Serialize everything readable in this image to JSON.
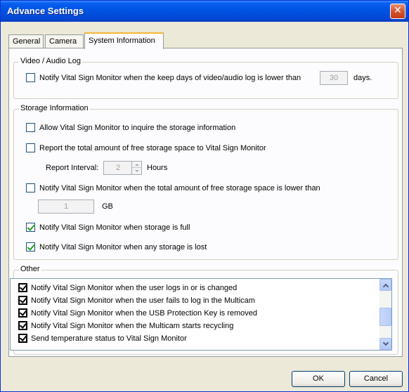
{
  "window": {
    "title": "Advance Settings",
    "close_glyph": "✕"
  },
  "tabs": [
    {
      "label": "General"
    },
    {
      "label": "Camera"
    },
    {
      "label": "System Information",
      "active": true
    }
  ],
  "video_audio": {
    "group_label": "Video / Audio Log",
    "notify_keep_days": {
      "label": "Notify Vital Sign Monitor when the keep days of video/audio log is lower than",
      "checked": false
    },
    "days_value": "30",
    "days_unit": "days."
  },
  "storage": {
    "group_label": "Storage Information",
    "allow_inquire": {
      "label": "Allow Vital Sign Monitor to inquire the storage information",
      "checked": false
    },
    "report_free": {
      "label": "Report the total amount of free storage space to Vital Sign Monitor",
      "checked": false
    },
    "interval_label": "Report Interval:",
    "interval_value": "2",
    "interval_unit": "Hours",
    "notify_low": {
      "label": "Notify Vital Sign Monitor when the total amount of free storage space is lower than",
      "checked": false
    },
    "gb_value": "1",
    "gb_unit": "GB",
    "notify_full": {
      "label": "Notify Vital Sign Monitor when storage is full",
      "checked": true
    },
    "notify_lost": {
      "label": "Notify Vital Sign Monitor when any storage is lost",
      "checked": true
    }
  },
  "other": {
    "group_label": "Other",
    "items": [
      {
        "label": "Notify Vital Sign Monitor when the user logs in or is changed",
        "checked": true
      },
      {
        "label": "Notify Vital Sign Monitor when the user fails to log in the Multicam",
        "checked": true
      },
      {
        "label": "Notify Vital Sign Monitor when the USB Protection Key is removed",
        "checked": true
      },
      {
        "label": "Notify Vital Sign Monitor when the Multicam starts recycling",
        "checked": true
      },
      {
        "label": "Send temperature status to Vital Sign Monitor",
        "checked": true
      }
    ]
  },
  "buttons": {
    "ok": "OK",
    "cancel": "Cancel"
  }
}
